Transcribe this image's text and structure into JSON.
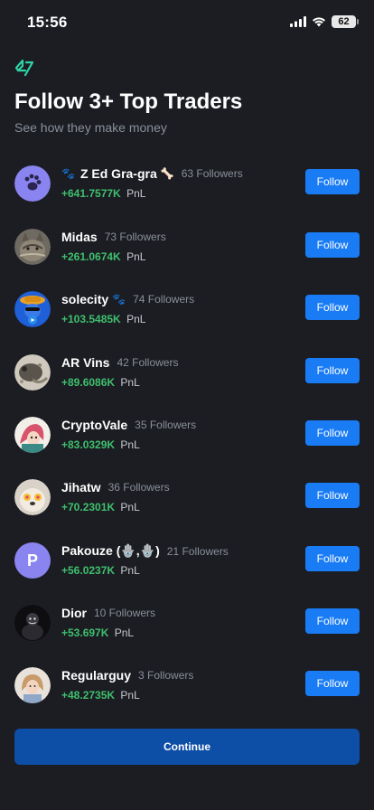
{
  "status_bar": {
    "time": "15:56",
    "battery": "62"
  },
  "header": {
    "title": "Follow 3+ Top Traders",
    "subtitle": "See how they make money"
  },
  "traders": [
    {
      "name": "Z Ed Gra-gra",
      "followers": "63 Followers",
      "pnl": "+641.7577K",
      "pnl_unit": "PnL",
      "name_prefix": "🐾",
      "name_suffix": "🦴",
      "avatar": "paw-avatar"
    },
    {
      "name": "Midas",
      "followers": "73 Followers",
      "pnl": "+261.0674K",
      "pnl_unit": "PnL",
      "avatar": "cat-avatar"
    },
    {
      "name": "solecity",
      "followers": "74 Followers",
      "pnl": "+103.5485K",
      "pnl_unit": "PnL",
      "name_suffix": "🐾",
      "avatar": "character-avatar"
    },
    {
      "name": "AR Vins",
      "followers": "42 Followers",
      "pnl": "+89.6086K",
      "pnl_unit": "PnL",
      "avatar": "animal-avatar"
    },
    {
      "name": "CryptoVale",
      "followers": "35 Followers",
      "pnl": "+83.0329K",
      "pnl_unit": "PnL",
      "avatar": "anime-avatar"
    },
    {
      "name": "Jihatw",
      "followers": "36 Followers",
      "pnl": "+70.2301K",
      "pnl_unit": "PnL",
      "avatar": "dog-avatar"
    },
    {
      "name": "Pakouze (🪬,🪬)",
      "followers": "21 Followers",
      "pnl": "+56.0237K",
      "pnl_unit": "PnL",
      "avatar_letter": "P",
      "avatar": "letter-avatar"
    },
    {
      "name": "Dior",
      "followers": "10 Followers",
      "pnl": "+53.697K",
      "pnl_unit": "PnL",
      "avatar": "dark-avatar"
    },
    {
      "name": "Regularguy",
      "followers": "3 Followers",
      "pnl": "+48.2735K",
      "pnl_unit": "PnL",
      "avatar": "person-avatar"
    }
  ],
  "follow_label": "Follow",
  "continue_label": "Continue",
  "colors": {
    "background": "#1b1d22",
    "accent": "#1a7cf5",
    "continue": "#0d4ea6",
    "pnl_positive": "#3fbf6e",
    "logo": "#2fd3a6",
    "avatar_purple": "#8a84f0"
  }
}
